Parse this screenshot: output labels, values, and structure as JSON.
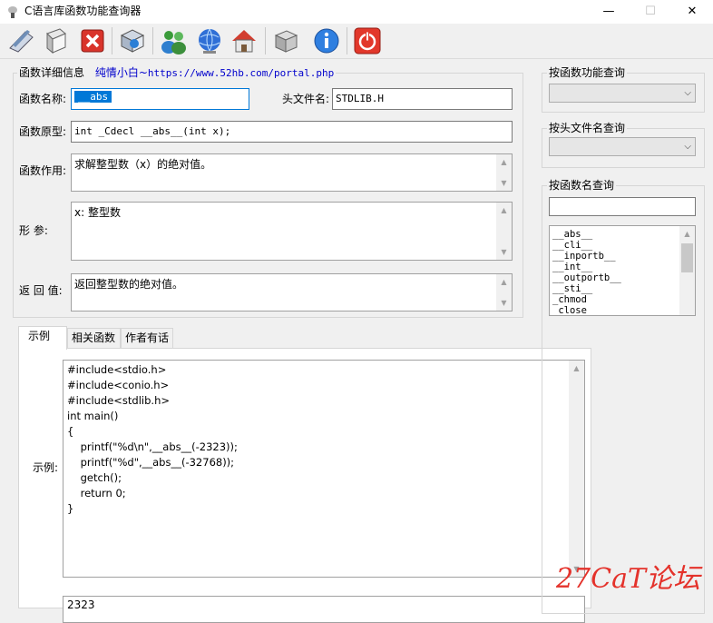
{
  "window": {
    "title": "C语言库函数功能查询器",
    "minimize": "—",
    "maximize": "☐",
    "close": "✕"
  },
  "toolbar": {
    "icons": [
      "pencil-book-icon",
      "book-icon",
      "close-red-icon",
      "web-app-icon",
      "users-icon",
      "globe-icon",
      "home-icon",
      "box-icon",
      "info-icon",
      "power-icon"
    ]
  },
  "details": {
    "group_title": "函数详细信息",
    "author_tag": "纯情小白~",
    "url": "https://www.52hb.com/portal.php",
    "name_label": "函数名称:",
    "name_value": "__abs",
    "header_label": "头文件名:",
    "header_value": "STDLIB.H",
    "prototype_label": "函数原型:",
    "prototype_value": "int     _Cdecl __abs__(int x);",
    "purpose_label": "函数作用:",
    "purpose_value": "求解整型数（x）的绝对值。",
    "param_label": "形    参:",
    "param_value": "x: 整型数",
    "return_label": "返 回 值:",
    "return_value": "返回整型数的绝对值。"
  },
  "tabs": [
    {
      "label": "示例"
    },
    {
      "label": "相关函数"
    },
    {
      "label": "作者有话"
    }
  ],
  "example": {
    "label": "示例:",
    "code": [
      "#include<stdio.h>",
      "#include<conio.h>",
      "#include<stdlib.h>",
      "int main()",
      "{",
      "    printf(\"%d\\n\",__abs__(-2323));",
      "    printf(\"%d\",__abs__(-32768));",
      "    getch();",
      "    return 0;",
      "}"
    ],
    "output_partial": "2323"
  },
  "side": {
    "by_function": "按函数功能查询",
    "by_header": "按头文件名查询",
    "by_name": "按函数名查询",
    "list": [
      "__abs__",
      "__cli__",
      "__inportb__",
      "__int__",
      "__outportb__",
      "__sti__",
      "_chmod",
      "_close"
    ]
  },
  "watermark": "27CaT论坛"
}
